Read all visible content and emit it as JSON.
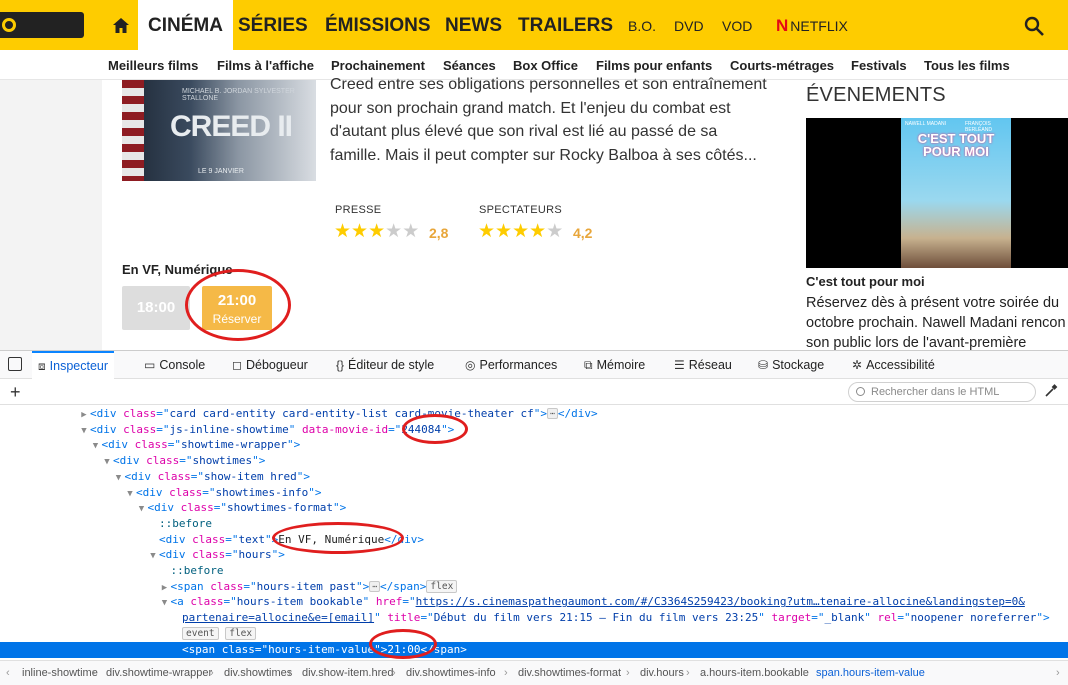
{
  "site": {
    "logo": "ALLOCINE",
    "nav_main": [
      "CINÉMA",
      "SÉRIES",
      "ÉMISSIONS",
      "NEWS",
      "TRAILERS"
    ],
    "nav_small": [
      "B.O.",
      "DVD",
      "VOD",
      "NETFLIX"
    ],
    "netflix_letter": "N",
    "subnav": [
      "Meilleurs films",
      "Films à l'affiche",
      "Prochainement",
      "Séances",
      "Box Office",
      "Films pour enfants",
      "Courts-métrages",
      "Festivals",
      "Tous les films"
    ]
  },
  "movie": {
    "poster_title": "CREED II",
    "poster_actors": "MICHAEL B. JORDAN   SYLVESTER STALLONE",
    "poster_date": "LE 9 JANVIER",
    "synopsis": "Creed entre ses obligations personnelles et son entraînement pour son prochain grand match. Et l'enjeu du combat est d'autant plus élevé que son rival est lié au passé de sa famille. Mais il peut compter sur Rocky Balboa à ses côtés...",
    "press_label": "PRESSE",
    "press_score": "2,8",
    "press_stars": 2.8,
    "spect_label": "SPECTATEURS",
    "spect_score": "4,2",
    "spect_stars": 4.2,
    "version": "En VF, Numérique",
    "hour_past": "18:00",
    "hour_book": "21:00",
    "book_label": "Réserver"
  },
  "events": {
    "title": "ÉVENEMENTS",
    "poster_title": "C'EST TOUT POUR MOI",
    "poster_actor_a": "NAWELL MADANI",
    "poster_actor_b": "FRANÇOIS BERLÉAND",
    "name": "C'est tout pour moi",
    "desc_lines": [
      "Réservez dès à présent votre soirée du",
      "octobre prochain. Nawell Madani rencon",
      "son public lors de l'avant-première"
    ]
  },
  "devtools": {
    "tabs": [
      "Inspecteur",
      "Console",
      "Débogueur",
      "Éditeur de style",
      "Performances",
      "Mémoire",
      "Réseau",
      "Stockage",
      "Accessibilité"
    ],
    "tab_icons": [
      "⧈",
      "▭",
      "◻",
      "{}",
      "◎",
      "⧉",
      "☰",
      "⛁",
      "✲"
    ],
    "search_placeholder": "Rechercher dans le HTML",
    "lines": [
      {
        "indent": 0,
        "twisty": "▶",
        "parts": [
          [
            "tag",
            "<div "
          ],
          [
            "an",
            "class"
          ],
          [
            "tag",
            "=\""
          ],
          [
            "av",
            "card card-entity card-entity-list card-movie-theater cf"
          ],
          [
            "tag",
            "\">"
          ],
          [
            "dots",
            "⋯"
          ],
          [
            "tag",
            "</div>"
          ]
        ]
      },
      {
        "indent": 0,
        "twisty": "▼",
        "parts": [
          [
            "tag",
            "<div "
          ],
          [
            "an",
            "class"
          ],
          [
            "tag",
            "=\""
          ],
          [
            "av",
            "js-inline-showtime"
          ],
          [
            "tag",
            "\" "
          ],
          [
            "an",
            "data-movie-id"
          ],
          [
            "tag",
            "=\""
          ],
          [
            "av",
            "244084"
          ],
          [
            "tag",
            "\">"
          ]
        ]
      },
      {
        "indent": 1,
        "twisty": "▼",
        "parts": [
          [
            "tag",
            "<div "
          ],
          [
            "an",
            "class"
          ],
          [
            "tag",
            "=\""
          ],
          [
            "av",
            "showtime-wrapper"
          ],
          [
            "tag",
            "\">"
          ]
        ]
      },
      {
        "indent": 2,
        "twisty": "▼",
        "parts": [
          [
            "tag",
            "<div "
          ],
          [
            "an",
            "class"
          ],
          [
            "tag",
            "=\""
          ],
          [
            "av",
            "showtimes"
          ],
          [
            "tag",
            "\">"
          ]
        ]
      },
      {
        "indent": 3,
        "twisty": "▼",
        "parts": [
          [
            "tag",
            "<div "
          ],
          [
            "an",
            "class"
          ],
          [
            "tag",
            "=\""
          ],
          [
            "av",
            "show-item hred"
          ],
          [
            "tag",
            "\">"
          ]
        ]
      },
      {
        "indent": 4,
        "twisty": "▼",
        "parts": [
          [
            "tag",
            "<div "
          ],
          [
            "an",
            "class"
          ],
          [
            "tag",
            "=\""
          ],
          [
            "av",
            "showtimes-info"
          ],
          [
            "tag",
            "\">"
          ]
        ]
      },
      {
        "indent": 5,
        "twisty": "▼",
        "parts": [
          [
            "tag",
            "<div "
          ],
          [
            "an",
            "class"
          ],
          [
            "tag",
            "=\""
          ],
          [
            "av",
            "showtimes-format"
          ],
          [
            "tag",
            "\">"
          ]
        ]
      },
      {
        "indent": 6,
        "twisty": "",
        "parts": [
          [
            "pn",
            "::before"
          ]
        ]
      },
      {
        "indent": 6,
        "twisty": "",
        "parts": [
          [
            "tag",
            "<div "
          ],
          [
            "an",
            "class"
          ],
          [
            "tag",
            "=\""
          ],
          [
            "av",
            "text"
          ],
          [
            "tag",
            "\">"
          ],
          [
            "txt",
            "En VF, Numérique"
          ],
          [
            "tag",
            "</div>"
          ]
        ]
      },
      {
        "indent": 6,
        "twisty": "▼",
        "parts": [
          [
            "tag",
            "<div "
          ],
          [
            "an",
            "class"
          ],
          [
            "tag",
            "=\""
          ],
          [
            "av",
            "hours"
          ],
          [
            "tag",
            "\">"
          ]
        ]
      },
      {
        "indent": 7,
        "twisty": "",
        "parts": [
          [
            "pn",
            "::before"
          ]
        ]
      },
      {
        "indent": 7,
        "twisty": "▶",
        "parts": [
          [
            "tag",
            "<span "
          ],
          [
            "an",
            "class"
          ],
          [
            "tag",
            "=\""
          ],
          [
            "av",
            "hours-item past"
          ],
          [
            "tag",
            "\">"
          ],
          [
            "dots",
            "⋯"
          ],
          [
            "tag",
            "</span>"
          ],
          [
            "badge",
            "flex"
          ]
        ]
      },
      {
        "indent": 7,
        "twisty": "▼",
        "parts": [
          [
            "tag",
            "<a "
          ],
          [
            "an",
            "class"
          ],
          [
            "tag",
            "=\""
          ],
          [
            "av",
            "hours-item bookable"
          ],
          [
            "tag",
            "\" "
          ],
          [
            "an",
            "href"
          ],
          [
            "tag",
            "=\""
          ],
          [
            "link",
            "https://s.cinemaspathegaumont.com/#/C3364S259423/booking?utm…tenaire-allocine&landingstep=0&"
          ]
        ]
      },
      {
        "indent": 8,
        "twisty": "",
        "parts": [
          [
            "link",
            "partenaire=allocine&e=[email]"
          ],
          [
            "tag",
            "\" "
          ],
          [
            "an",
            "title"
          ],
          [
            "tag",
            "=\""
          ],
          [
            "av",
            "Début du film vers 21:15 – Fin du film vers 23:25"
          ],
          [
            "tag",
            "\" "
          ],
          [
            "an",
            "target"
          ],
          [
            "tag",
            "=\""
          ],
          [
            "av",
            "_blank"
          ],
          [
            "tag",
            "\" "
          ],
          [
            "an",
            "rel"
          ],
          [
            "tag",
            "=\""
          ],
          [
            "av",
            "noopener noreferrer"
          ],
          [
            "tag",
            "\">"
          ]
        ]
      },
      {
        "indent": 8,
        "twisty": "",
        "parts": [
          [
            "badge",
            "event"
          ],
          [
            "sp",
            " "
          ],
          [
            "badge",
            "flex"
          ]
        ]
      },
      {
        "indent": 8,
        "twisty": "",
        "sel": true,
        "parts": [
          [
            "tag",
            "<span "
          ],
          [
            "an",
            "class"
          ],
          [
            "tag",
            "=\""
          ],
          [
            "av",
            "hours-item-value"
          ],
          [
            "tag",
            "\">"
          ],
          [
            "txt",
            "21:00"
          ],
          [
            "tag",
            "</span>"
          ]
        ]
      }
    ],
    "breadcrumb": [
      "inline-showtime",
      "div.showtime-wrapper",
      "div.showtimes",
      "div.show-item.hred",
      "div.showtimes-info",
      "div.showtimes-format",
      "div.hours",
      "a.hours-item.bookable",
      "span.hours-item-value"
    ]
  },
  "colors": {
    "brand": "#fecc00",
    "book_button": "#f5b947",
    "annotation": "#e01e1e",
    "selection": "#0074e8"
  }
}
